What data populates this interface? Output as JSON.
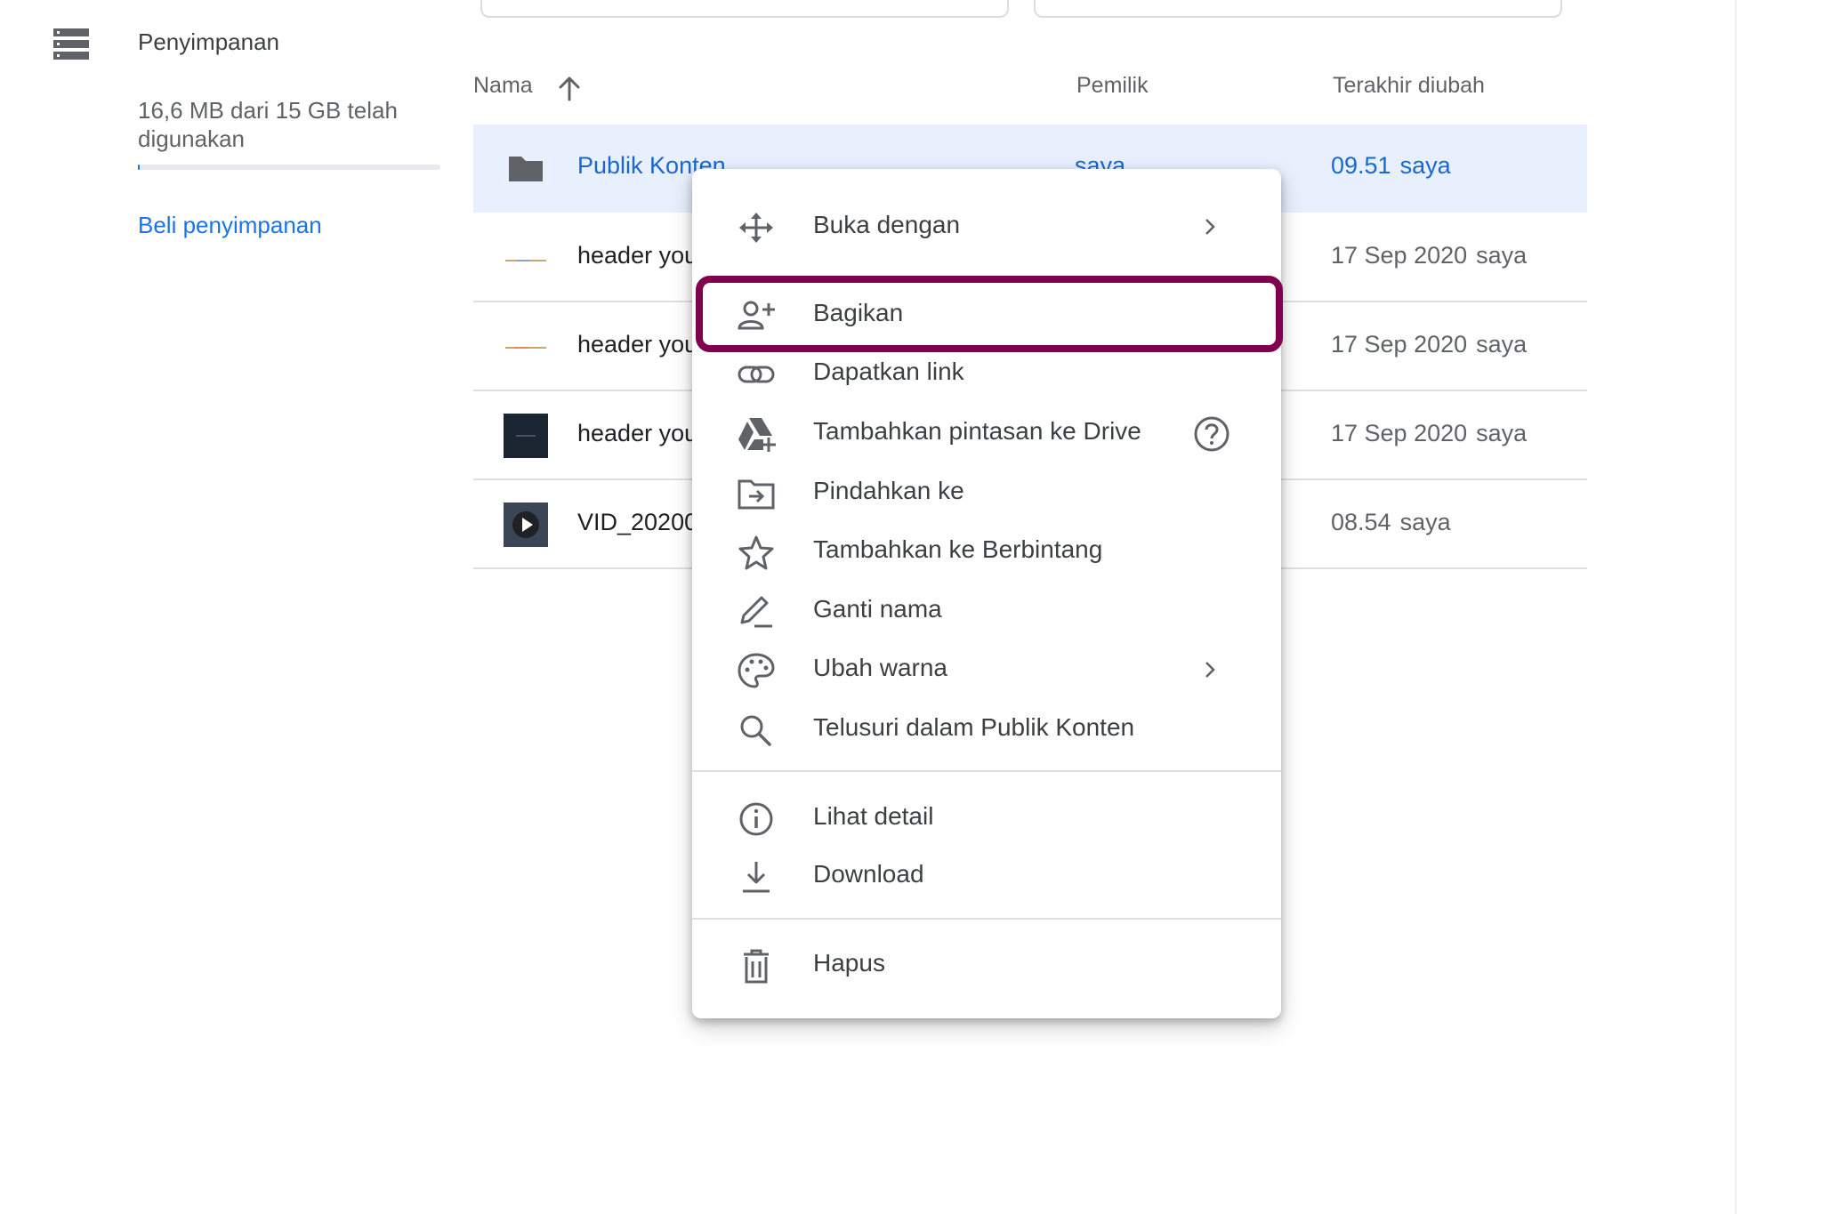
{
  "sidebar": {
    "storage_title": "Penyimpanan",
    "storage_usage": "16,6 MB dari 15 GB telah digunakan",
    "storage_fraction": 0.0011,
    "buy_storage": "Beli penyimpanan"
  },
  "table": {
    "headers": {
      "name": "Nama",
      "owner": "Pemilik",
      "modified": "Terakhir diubah"
    },
    "rows": [
      {
        "name": "Publik Konten",
        "owner": "saya",
        "date": "09.51",
        "modified_by": "saya",
        "thumb": "folder-icon",
        "selected": true
      },
      {
        "name": "header you",
        "owner": "",
        "date": "17 Sep 2020",
        "modified_by": "saya",
        "thumb": "image-thumbnail"
      },
      {
        "name": "header you",
        "owner": "",
        "date": "17 Sep 2020",
        "modified_by": "saya",
        "thumb": "image-thumbnail"
      },
      {
        "name": "header you",
        "owner": "",
        "date": "17 Sep 2020",
        "modified_by": "saya",
        "thumb": "dark-image-thumbnail"
      },
      {
        "name": "VID_20200",
        "owner": "",
        "date": "08.54",
        "modified_by": "saya",
        "thumb": "video-thumbnail"
      }
    ]
  },
  "context_menu": {
    "items": [
      {
        "label": "Buka dengan",
        "icon": "move-arrows-icon",
        "submenu": true
      },
      {
        "label": "Bagikan",
        "icon": "add-person-icon",
        "highlighted": true
      },
      {
        "label": "Dapatkan link",
        "icon": "link-icon"
      },
      {
        "label": "Tambahkan pintasan ke Drive",
        "icon": "drive-add-icon",
        "help": true
      },
      {
        "label": "Pindahkan ke",
        "icon": "move-to-folder-icon"
      },
      {
        "label": "Tambahkan ke Berbintang",
        "icon": "star-icon"
      },
      {
        "label": "Ganti nama",
        "icon": "pencil-icon"
      },
      {
        "label": "Ubah warna",
        "icon": "palette-icon",
        "submenu": true
      },
      {
        "label": "Telusuri dalam Publik Konten",
        "icon": "search-icon"
      },
      {
        "label": "Lihat detail",
        "icon": "info-icon"
      },
      {
        "label": "Download",
        "icon": "download-icon"
      },
      {
        "label": "Hapus",
        "icon": "trash-icon"
      }
    ]
  },
  "colors": {
    "accent": "#1a73e8",
    "selected_row": "#e8f0fe",
    "highlight_border": "#800050"
  }
}
